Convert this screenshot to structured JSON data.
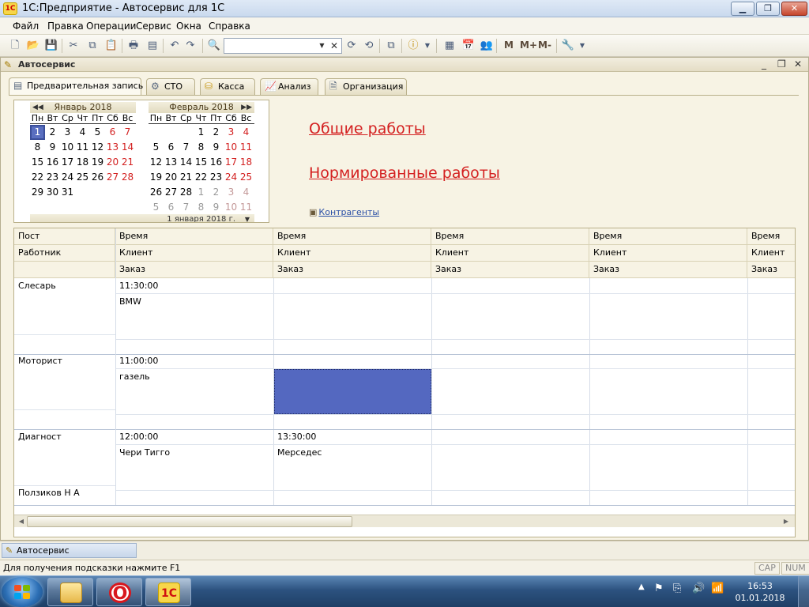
{
  "window": {
    "title": "1С:Предприятие - Автосервис для 1С",
    "logo": "1C"
  },
  "menu": [
    {
      "label": "Файл",
      "key": "Ф"
    },
    {
      "label": "Правка",
      "key": "П"
    },
    {
      "label": "Операции",
      "key": "О"
    },
    {
      "label": "Сервис",
      "key": "С"
    },
    {
      "label": "Окна",
      "key": "О"
    },
    {
      "label": "Справка",
      "key": "С"
    }
  ],
  "menu_labels": [
    "Файл",
    "Правка",
    "Операции",
    "Сервис",
    "Окна",
    "Справка"
  ],
  "toolbar": {
    "search_value": "",
    "m_label": "M",
    "mplus_label": "M+",
    "mminus_label": "M-"
  },
  "document": {
    "title": "Автосервис"
  },
  "tabs": [
    {
      "label": "Предварительная запись",
      "icon": "calendar-icon",
      "active": true
    },
    {
      "label": "СТО",
      "icon": "gear-icon"
    },
    {
      "label": "Касса",
      "icon": "cash-icon"
    },
    {
      "label": "Анализ",
      "icon": "chart-icon"
    },
    {
      "label": "Организация",
      "icon": "document-icon"
    }
  ],
  "calendar": {
    "dows": [
      "Пн",
      "Вт",
      "Ср",
      "Чт",
      "Пт",
      "Сб",
      "Вс"
    ],
    "months": [
      {
        "title": "Январь 2018",
        "days": [
          [
            1,
            2,
            3,
            4,
            5,
            6,
            7
          ],
          [
            8,
            9,
            10,
            11,
            12,
            13,
            14
          ],
          [
            15,
            16,
            17,
            18,
            19,
            20,
            21
          ],
          [
            22,
            23,
            24,
            25,
            26,
            27,
            28
          ],
          [
            29,
            30,
            31
          ]
        ],
        "selected": 1
      },
      {
        "title": "Февраль 2018",
        "days": [
          [
            null,
            null,
            null,
            1,
            2,
            3,
            4
          ],
          [
            5,
            6,
            7,
            8,
            9,
            10,
            11
          ],
          [
            12,
            13,
            14,
            15,
            16,
            17,
            18
          ],
          [
            19,
            20,
            21,
            22,
            23,
            24,
            25
          ],
          [
            26,
            27,
            28,
            1,
            2,
            3,
            4
          ],
          [
            5,
            6,
            7,
            8,
            9,
            10,
            11
          ]
        ],
        "other_month_from_row": 4,
        "other_month_from_col": 3
      }
    ],
    "current_date": "1 января 2018 г."
  },
  "links": {
    "general": "Общие работы",
    "normed": "Нормированные работы",
    "contractors": "Контрагенты"
  },
  "schedule": {
    "left_headers": [
      "Пост",
      "Работник"
    ],
    "slot_headers": [
      "Время",
      "Клиент",
      "Заказ"
    ],
    "slot_count": 5,
    "rows": [
      {
        "post": "Слесарь",
        "worker": "",
        "slots": [
          {
            "time": "11:30:00",
            "client": "BMW"
          }
        ]
      },
      {
        "post": "Моторист",
        "worker": "",
        "slots": [
          {
            "time": "11:00:00",
            "client": "газель"
          },
          {
            "selected": true
          }
        ]
      },
      {
        "post": "Диагност",
        "worker": "Ползиков Н А",
        "slots": [
          {
            "time": "12:00:00",
            "client": "Чери Тигго"
          },
          {
            "time": "13:30:00",
            "client": "Мерседес"
          }
        ]
      }
    ]
  },
  "window_tab": {
    "label": "Автосервис"
  },
  "status": {
    "hint": "Для получения подсказки нажмите F1",
    "cap": "CAP",
    "num": "NUM"
  },
  "taskbar": {
    "time": "16:53",
    "date": "01.01.2018"
  }
}
